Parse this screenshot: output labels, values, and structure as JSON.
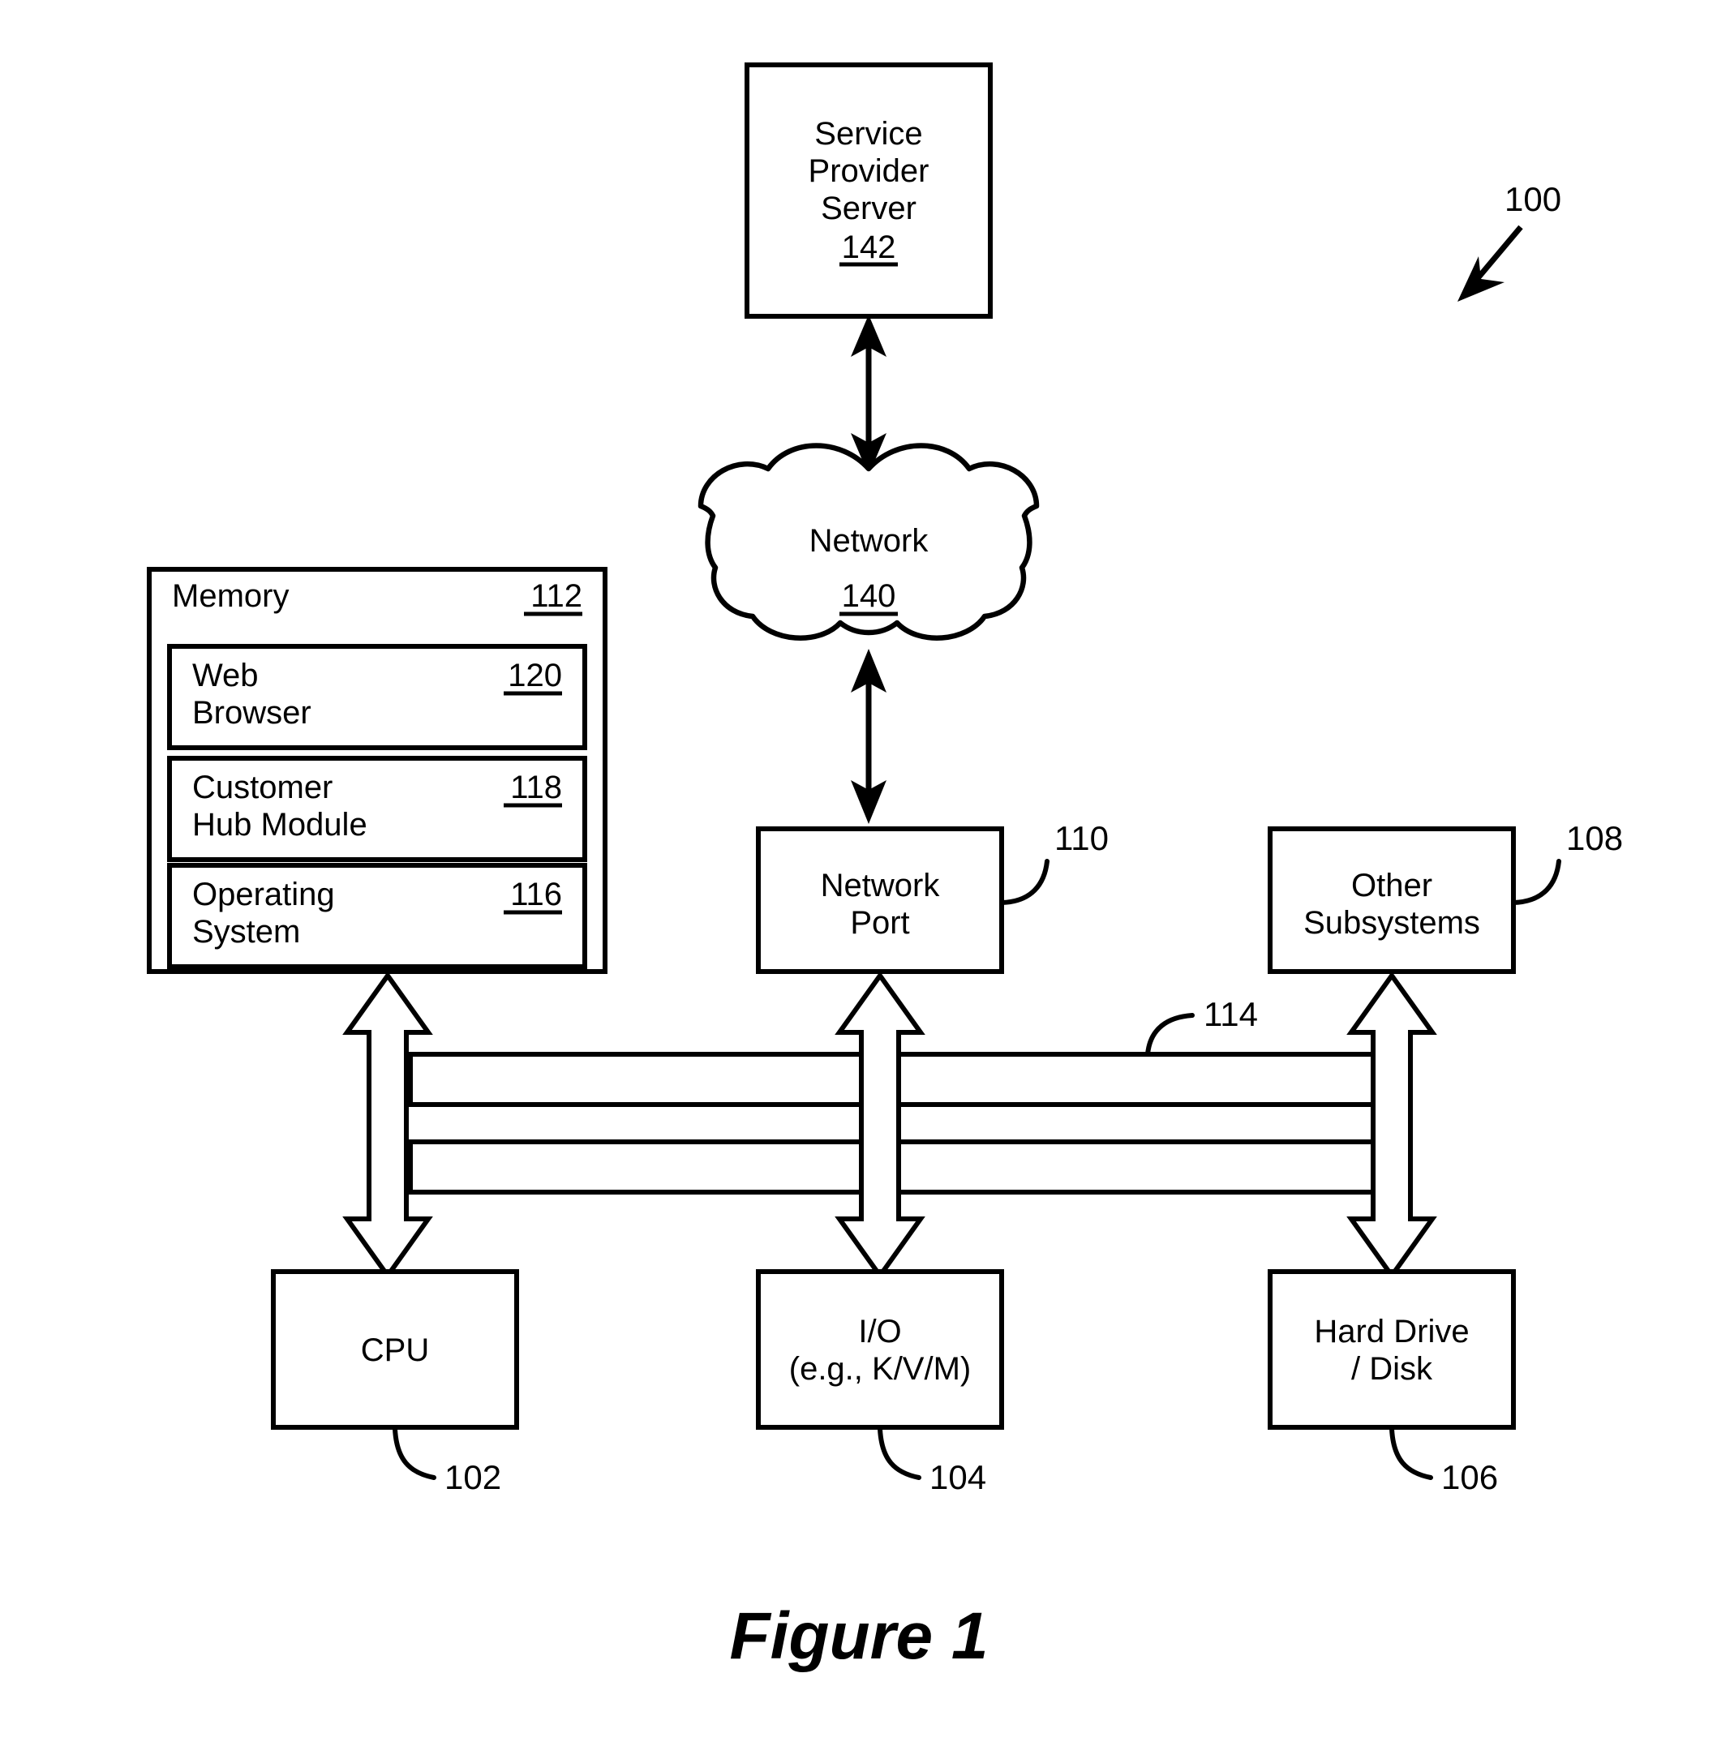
{
  "figure": {
    "caption": "Figure 1",
    "system_ref": "100"
  },
  "nodes": {
    "service_provider_server": {
      "name": "service-provider-server",
      "lines": [
        "Service",
        "Provider",
        "Server"
      ],
      "ref": "142",
      "ref_underlined": true
    },
    "network_cloud": {
      "name": "network-cloud",
      "label": "Network",
      "ref": "140",
      "ref_underlined": true
    },
    "memory": {
      "name": "memory",
      "label": "Memory",
      "ref": "112",
      "ref_underlined": true,
      "modules": [
        {
          "name": "web-browser-module",
          "lines": [
            "Web",
            "Browser"
          ],
          "ref": "120",
          "ref_underlined": true
        },
        {
          "name": "customer-hub-module",
          "lines": [
            "Customer",
            "Hub Module"
          ],
          "ref": "118",
          "ref_underlined": true
        },
        {
          "name": "operating-system-module",
          "lines": [
            "Operating",
            "System"
          ],
          "ref": "116",
          "ref_underlined": true
        }
      ]
    },
    "network_port": {
      "name": "network-port",
      "lines": [
        "Network",
        "Port"
      ],
      "ref": "110",
      "ref_underlined": false
    },
    "other_subsystems": {
      "name": "other-subsystems",
      "lines": [
        "Other",
        "Subsystems"
      ],
      "ref": "108",
      "ref_underlined": false
    },
    "cpu": {
      "name": "cpu",
      "lines": [
        "CPU"
      ],
      "ref": "102",
      "ref_underlined": false
    },
    "io": {
      "name": "io-device",
      "lines": [
        "I/O",
        "(e.g., K/V/M)"
      ],
      "ref": "104",
      "ref_underlined": false
    },
    "hard_drive": {
      "name": "hard-drive-disk",
      "lines": [
        "Hard Drive",
        "/ Disk"
      ],
      "ref": "106",
      "ref_underlined": false
    },
    "bus": {
      "name": "system-bus",
      "ref": "114",
      "ref_underlined": false
    }
  },
  "colors": {
    "stroke": "#000000",
    "fill": "#ffffff"
  }
}
